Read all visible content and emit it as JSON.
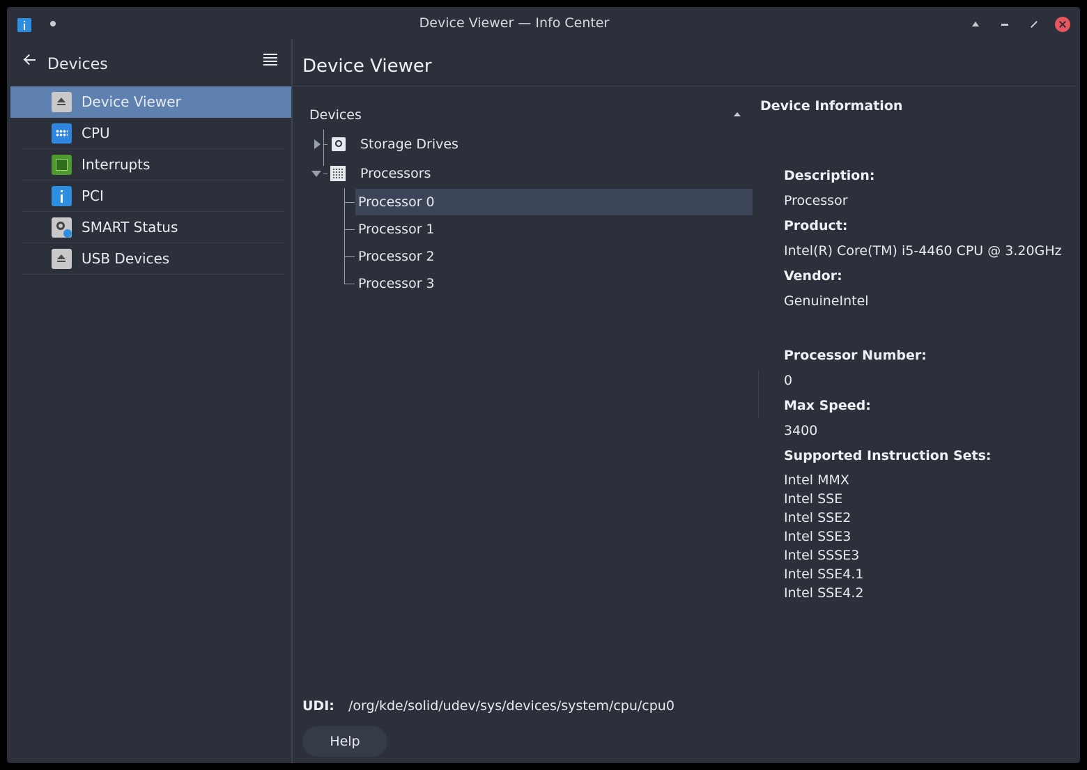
{
  "window": {
    "title": "Device Viewer — Info Center"
  },
  "sidebar": {
    "title": "Devices",
    "items": [
      {
        "label": "Device Viewer",
        "icon": "device-viewer-icon",
        "selected": true
      },
      {
        "label": "CPU",
        "icon": "cpu-icon"
      },
      {
        "label": "Interrupts",
        "icon": "interrupts-icon"
      },
      {
        "label": "PCI",
        "icon": "pci-info-icon"
      },
      {
        "label": "SMART Status",
        "icon": "smart-status-icon"
      },
      {
        "label": "USB Devices",
        "icon": "usb-devices-icon"
      }
    ]
  },
  "main": {
    "title": "Device Viewer",
    "tree": {
      "header": "Devices",
      "nodes": [
        {
          "label": "Storage Drives",
          "expanded": false
        },
        {
          "label": "Processors",
          "expanded": true,
          "children": [
            "Processor 0",
            "Processor 1",
            "Processor 2",
            "Processor 3"
          ]
        }
      ],
      "selected": "Processor 0"
    },
    "info": {
      "header": "Device Information",
      "description_label": "Description:",
      "description": "Processor",
      "product_label": "Product:",
      "product": "Intel(R) Core(TM) i5-4460  CPU @ 3.20GHz",
      "vendor_label": "Vendor:",
      "vendor": "GenuineIntel",
      "proc_number_label": "Processor Number:",
      "proc_number": "0",
      "max_speed_label": "Max Speed:",
      "max_speed": "3400",
      "instruction_sets_label": "Supported Instruction Sets:",
      "instruction_sets": [
        "Intel MMX",
        "Intel SSE",
        "Intel SSE2",
        "Intel SSE3",
        "Intel SSSE3",
        "Intel SSE4.1",
        "Intel SSE4.2"
      ]
    },
    "udi_label": "UDI:",
    "udi": "/org/kde/solid/udev/sys/devices/system/cpu/cpu0",
    "help_label": "Help"
  },
  "colors": {
    "background": "#2b303b",
    "selection": "#5e81b0",
    "tree_selection": "#3c4558",
    "close_button": "#e9555e"
  }
}
